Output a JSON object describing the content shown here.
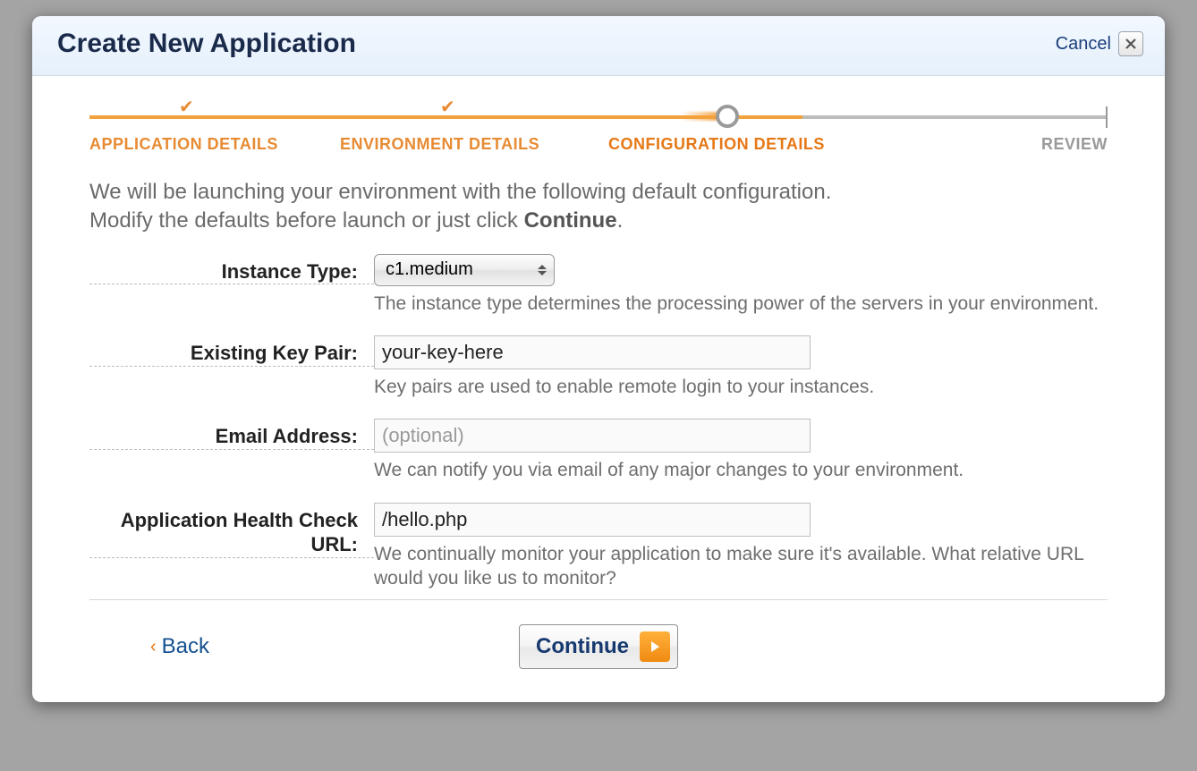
{
  "dialog": {
    "title": "Create New Application",
    "cancel": "Cancel"
  },
  "wizard": {
    "steps": [
      {
        "label": "APPLICATION DETAILS",
        "state": "done"
      },
      {
        "label": "ENVIRONMENT DETAILS",
        "state": "done"
      },
      {
        "label": "CONFIGURATION DETAILS",
        "state": "current"
      },
      {
        "label": "REVIEW",
        "state": "upcoming"
      }
    ]
  },
  "intro": {
    "line1": "We will be launching your environment with the following default configuration.",
    "line2_prefix": "Modify the defaults before launch or just click ",
    "line2_bold": "Continue",
    "line2_suffix": "."
  },
  "form": {
    "instance_type": {
      "label": "Instance Type:",
      "value": "c1.medium",
      "help": "The instance type determines the processing power of the servers in your environment."
    },
    "key_pair": {
      "label": "Existing Key Pair:",
      "value": "your-key-here",
      "help": "Key pairs are used to enable remote login to your instances."
    },
    "email": {
      "label": "Email Address:",
      "value": "",
      "placeholder": "(optional)",
      "help": "We can notify you via email of any major changes to your environment."
    },
    "healthcheck": {
      "label": "Application Health Check URL:",
      "value": "/hello.php",
      "help": "We continually monitor your application to make sure it's available. What relative URL would you like us to monitor?"
    }
  },
  "footer": {
    "back": "Back",
    "continue": "Continue"
  },
  "colors": {
    "accent": "#e67817",
    "track_done": "#f2a23d",
    "track_todo": "#bdbdbd"
  }
}
